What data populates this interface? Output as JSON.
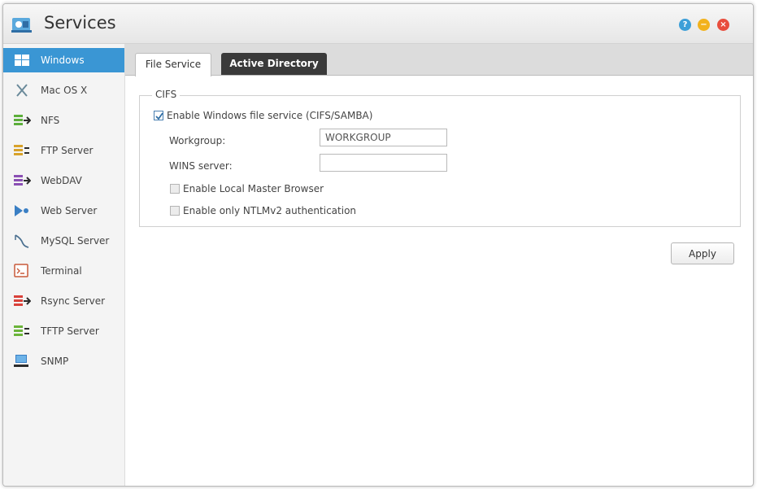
{
  "window": {
    "title": "Services",
    "title_buttons": [
      "help-icon",
      "minimize-icon",
      "close-icon"
    ]
  },
  "sidebar": {
    "items": [
      {
        "label": "Windows",
        "icon": "windows-icon",
        "active": true
      },
      {
        "label": "Mac OS X",
        "icon": "mac-os-x-icon",
        "active": false
      },
      {
        "label": "NFS",
        "icon": "nfs-icon",
        "active": false
      },
      {
        "label": "FTP Server",
        "icon": "ftp-server-icon",
        "active": false
      },
      {
        "label": "WebDAV",
        "icon": "webdav-icon",
        "active": false
      },
      {
        "label": "Web Server",
        "icon": "web-server-icon",
        "active": false
      },
      {
        "label": "MySQL Server",
        "icon": "mysql-icon",
        "active": false
      },
      {
        "label": "Terminal",
        "icon": "terminal-icon",
        "active": false
      },
      {
        "label": "Rsync Server",
        "icon": "rsync-icon",
        "active": false
      },
      {
        "label": "TFTP Server",
        "icon": "tftp-server-icon",
        "active": false
      },
      {
        "label": "SNMP",
        "icon": "snmp-icon",
        "active": false
      }
    ]
  },
  "tabs": [
    {
      "label": "File Service",
      "selected": true
    },
    {
      "label": "Active Directory",
      "selected": false
    }
  ],
  "cifs": {
    "legend": "CIFS",
    "enable_label": "Enable Windows file service (CIFS/SAMBA)",
    "enable_checked": true,
    "workgroup_label": "Workgroup:",
    "workgroup_value": "WORKGROUP",
    "wins_label": "WINS server:",
    "wins_value": "",
    "local_master_label": "Enable Local Master Browser",
    "local_master_checked": false,
    "ntlm_label": "Enable only NTLMv2 authentication",
    "ntlm_checked": false
  },
  "apply_label": "Apply",
  "colors": {
    "accent": "#3a96d4",
    "tab_active_dark": "#3a3a3a",
    "help": "#3d9fd8",
    "minimize": "#f2b21d",
    "close": "#e84d3d"
  }
}
